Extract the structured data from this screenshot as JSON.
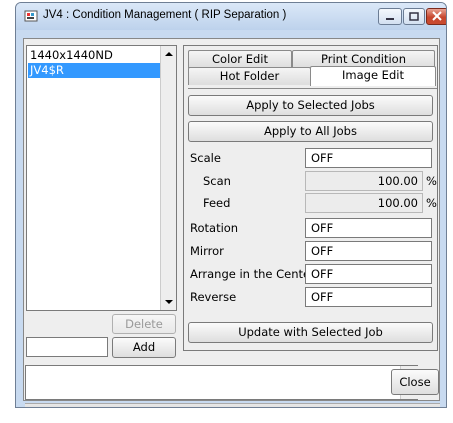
{
  "window": {
    "title": "JV4 : Condition Management ( RIP Separation )"
  },
  "list": {
    "items": [
      "1440x1440ND",
      "JV4$R"
    ],
    "selected_index": 1
  },
  "left_buttons": {
    "delete_label": "Delete",
    "add_label": "Add",
    "add_input_value": ""
  },
  "tabs": {
    "row1": [
      "Color Edit",
      "Print Condition"
    ],
    "row2": [
      "Hot Folder",
      "Image Edit"
    ],
    "active": "Image Edit"
  },
  "actions": {
    "apply_selected": "Apply to Selected Jobs",
    "apply_all": "Apply to All Jobs",
    "update": "Update with Selected Job"
  },
  "settings": {
    "scale_label": "Scale",
    "scale_value": "OFF",
    "scan_label": "Scan",
    "scan_value": "100.00",
    "feed_label": "Feed",
    "feed_value": "100.00",
    "percent": "%",
    "rotation_label": "Rotation",
    "rotation_value": "OFF",
    "mirror_label": "Mirror",
    "mirror_value": "OFF",
    "arrange_label": "Arrange in the Center",
    "arrange_value": "OFF",
    "reverse_label": "Reverse",
    "reverse_value": "OFF"
  },
  "footer": {
    "close_label": "Close",
    "status_text": ""
  },
  "colors": {
    "selection": "#3399ff",
    "close_button": "#c7462e"
  }
}
